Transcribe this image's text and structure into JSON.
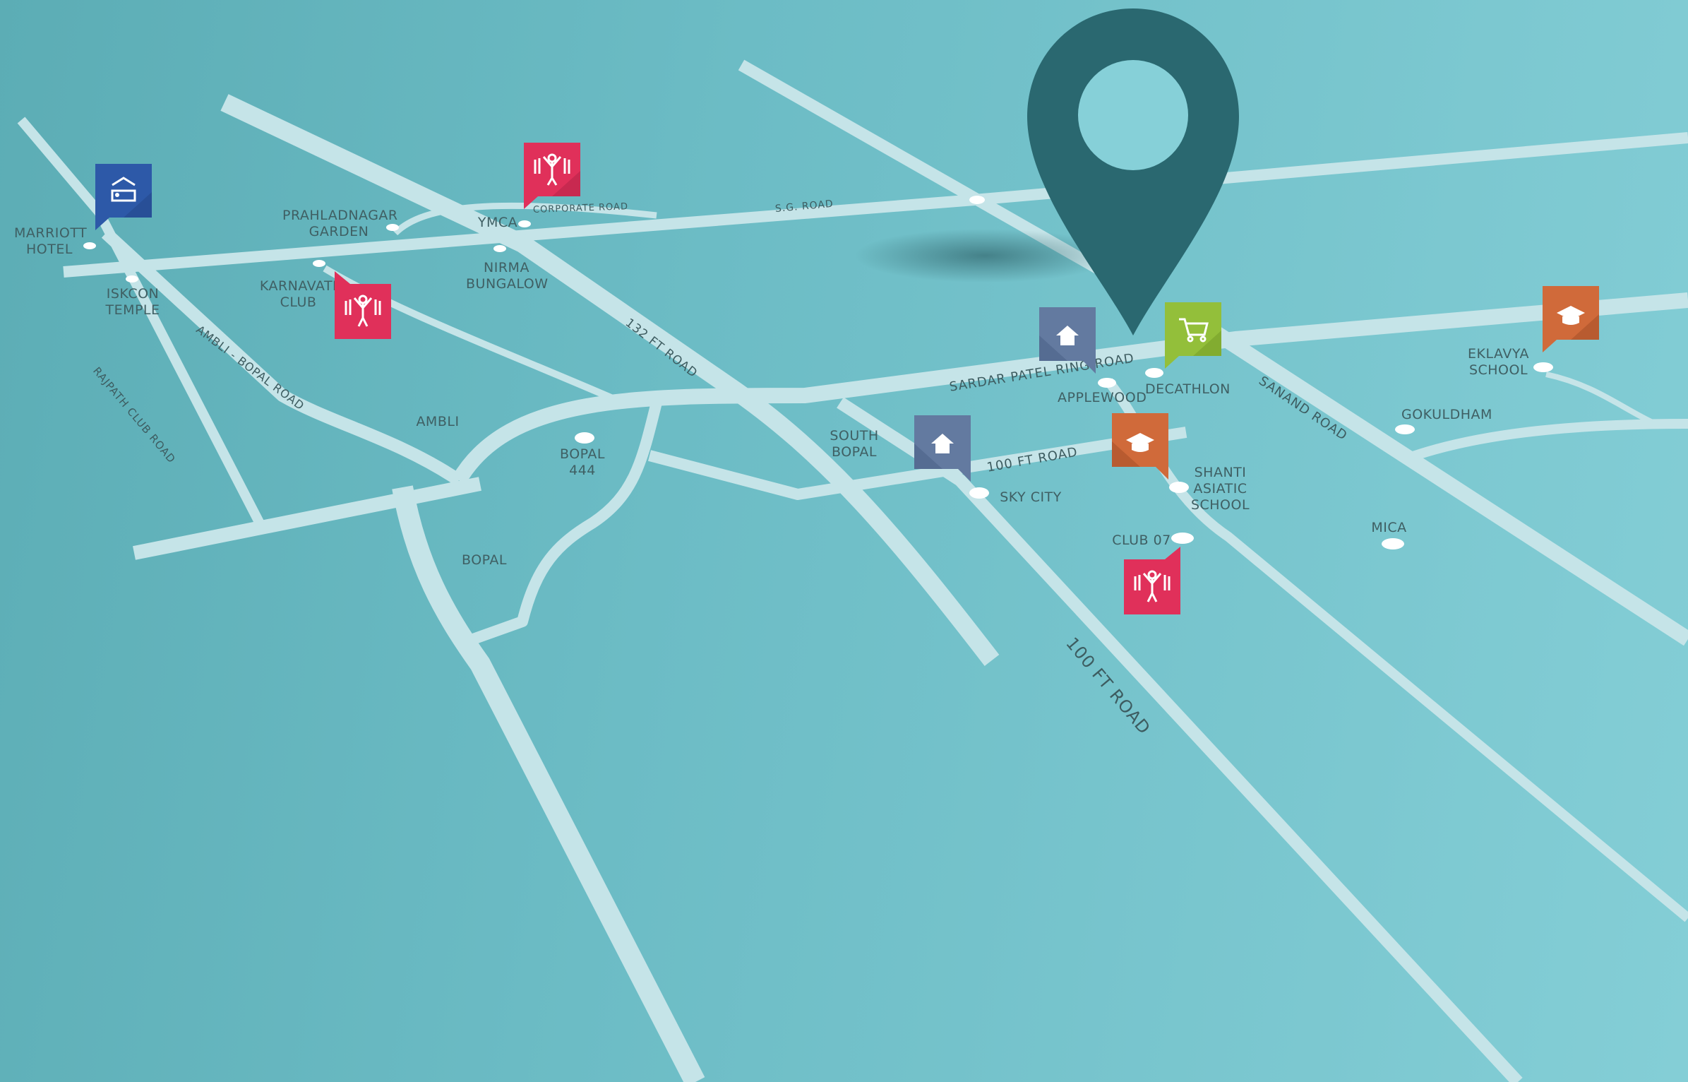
{
  "map": {
    "colors": {
      "water": "#6bbcc5",
      "road": "#c5e4e8",
      "pin": "#2a6870",
      "hotel": "#2d59a8",
      "club": "#e0305a",
      "housing": "#637aa0",
      "shopping": "#93bf3a",
      "school": "#d06a3a"
    },
    "roads": [
      "S.G. ROAD",
      "CORPORATE ROAD",
      "132 FT ROAD",
      "AMBLI - BOPAL ROAD",
      "RAJPATH CLUB ROAD",
      "SARDAR PATEL RING ROAD",
      "SANAND ROAD",
      "100 FT ROAD",
      "100 FT ROAD"
    ],
    "places": [
      [
        "MARRIOTT",
        "HOTEL"
      ],
      [
        "ISKCON",
        "TEMPLE"
      ],
      [
        "PRAHLADNAGAR",
        "GARDEN"
      ],
      [
        "KARNAVATI",
        "CLUB"
      ],
      [
        "YMCA"
      ],
      [
        "NIRMA",
        "BUNGALOW"
      ],
      [
        "AMBLI"
      ],
      [
        "BOPAL",
        "444"
      ],
      [
        "BOPAL"
      ],
      [
        "SOUTH",
        "BOPAL"
      ],
      [
        "SKY CITY"
      ],
      [
        "APPLEWOOD"
      ],
      [
        "DECATHLON"
      ],
      [
        "SHANTI",
        "ASIATIC",
        "SCHOOL"
      ],
      [
        "CLUB 07"
      ],
      [
        "EKLAVYA",
        "SCHOOL"
      ],
      [
        "GOKULDHAM"
      ],
      [
        "MICA"
      ]
    ],
    "icons": [
      "hotel-icon",
      "club-icon",
      "club-icon",
      "housing-icon",
      "housing-icon",
      "shopping-cart-icon",
      "school-icon",
      "school-icon",
      "club-icon"
    ]
  }
}
